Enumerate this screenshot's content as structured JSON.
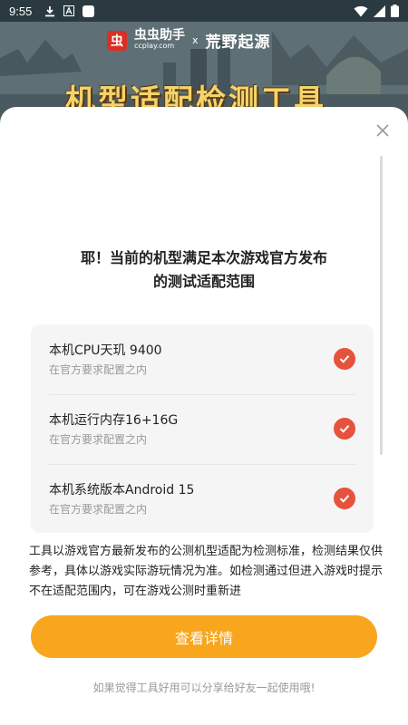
{
  "status_bar": {
    "time": "9:55",
    "left_icons": [
      "download-icon",
      "a-icon",
      "square-icon"
    ],
    "right_icons": [
      "wifi-icon",
      "signal-icon",
      "battery-icon"
    ]
  },
  "banner": {
    "logo_brand": "虫虫助手",
    "logo_sub": "ccplay.com",
    "logo_x": "x",
    "logo_partner": "荒野起源",
    "title": "机型适配检测工具"
  },
  "headline_line1": "耶！当前的机型满足本次游戏官方发布",
  "headline_line2": "的测试适配范围",
  "checks": [
    {
      "title": "本机CPU天玑 9400",
      "subtitle": "在官方要求配置之内"
    },
    {
      "title": "本机运行内存16+16G",
      "subtitle": "在官方要求配置之内"
    },
    {
      "title": "本机系统版本Android 15",
      "subtitle": "在官方要求配置之内"
    }
  ],
  "disclaimer": "工具以游戏官方最新发布的公测机型适配为检测标准，检测结果仅供参考，具体以游戏实际游玩情况为准。如检测通过但进入游戏时提示不在适配范围内，可在游戏公测时重新进",
  "primary_button": "查看详情",
  "footer_note": "如果觉得工具好用可以分享给好友一起使用哦!",
  "colors": {
    "accent": "#f8a61e",
    "check": "#e5533d"
  }
}
